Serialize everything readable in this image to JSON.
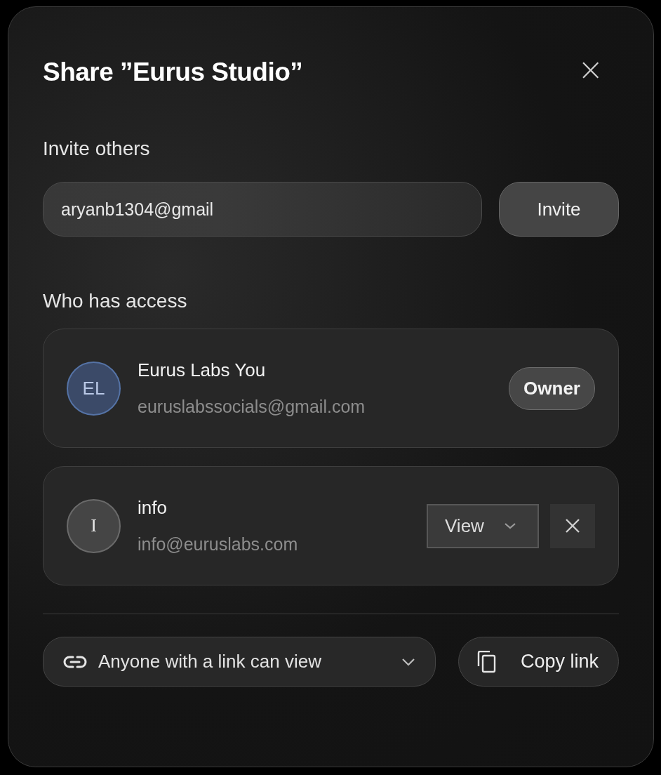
{
  "dialog": {
    "title": "Share ”Eurus Studio”",
    "close": "×"
  },
  "invite": {
    "heading": "Invite others",
    "value": "aryanb1304@gmail",
    "button": "Invite"
  },
  "access": {
    "heading": "Who has access",
    "members": [
      {
        "kind": "owner",
        "initials": "EL",
        "color": "#3b4a68",
        "name": "Eurus Labs You",
        "email": "euruslabssocials@gmail.com",
        "role": "Owner"
      },
      {
        "kind": "member",
        "initials": "I",
        "color": "#454545",
        "name": "info",
        "email": "info@euruslabs.com",
        "role": "View"
      }
    ]
  },
  "footer": {
    "link_setting": "Anyone with a link can view",
    "copy": "Copy link"
  }
}
